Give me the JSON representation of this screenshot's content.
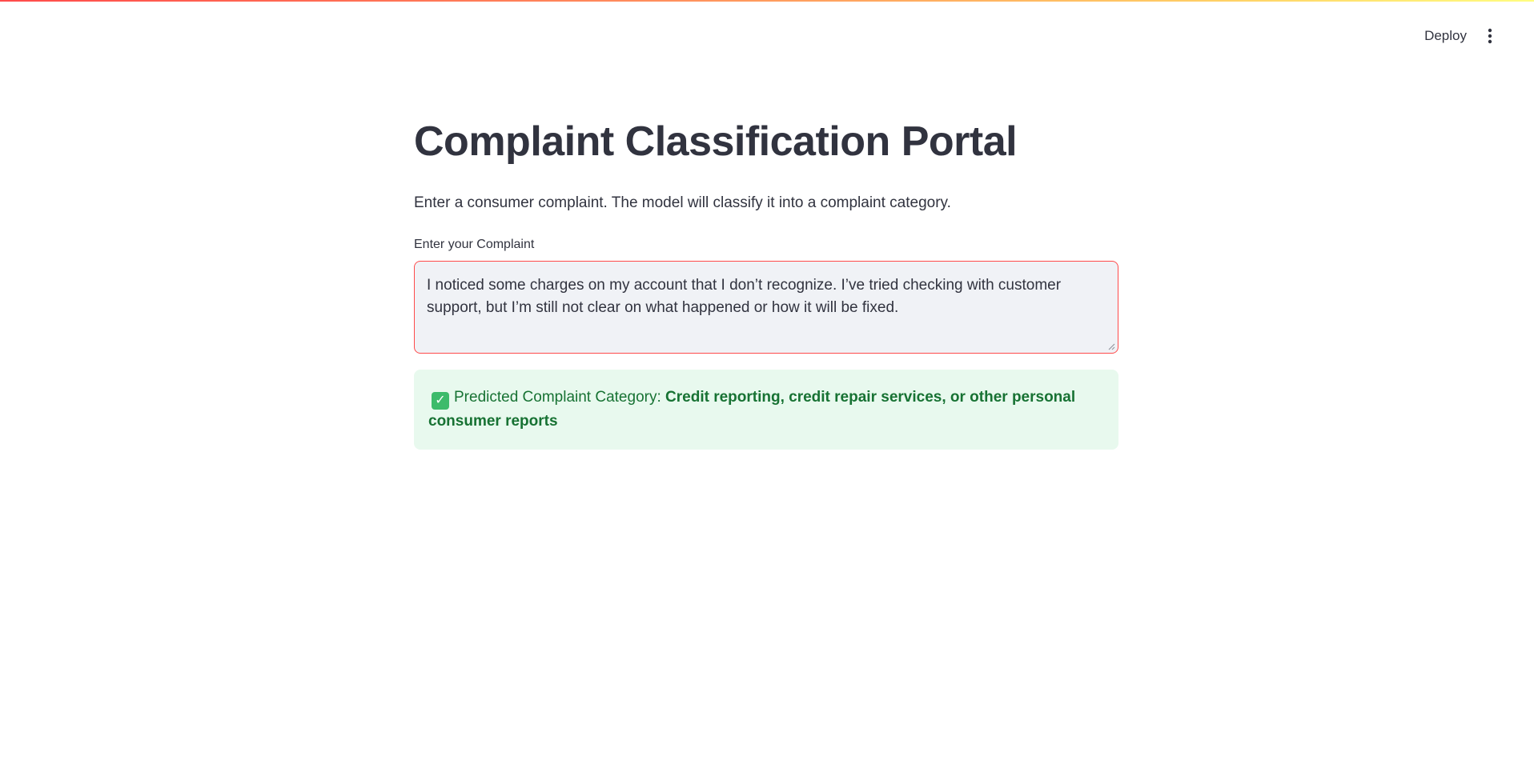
{
  "header": {
    "deploy_label": "Deploy",
    "menu_icon": "kebab-menu-icon"
  },
  "main": {
    "title": "Complaint Classification Portal",
    "description": "Enter a consumer complaint. The model will classify it into a complaint category.",
    "complaint_field": {
      "label": "Enter your Complaint",
      "value": "I noticed some charges on my account that I don’t recognize. I’ve tried checking with customer support, but I’m still not clear on what happened or how it will be fixed."
    },
    "result": {
      "icon": "check-mark-icon",
      "icon_glyph": "✓",
      "label": "Predicted Complaint Category:",
      "value": "Credit reporting, credit repair services, or other personal consumer reports"
    }
  },
  "colors": {
    "accent": "#ff4b4b",
    "success_bg": "#e8f9ee",
    "success_text": "#177233",
    "text": "#31333f",
    "input_bg": "#f0f2f6"
  }
}
